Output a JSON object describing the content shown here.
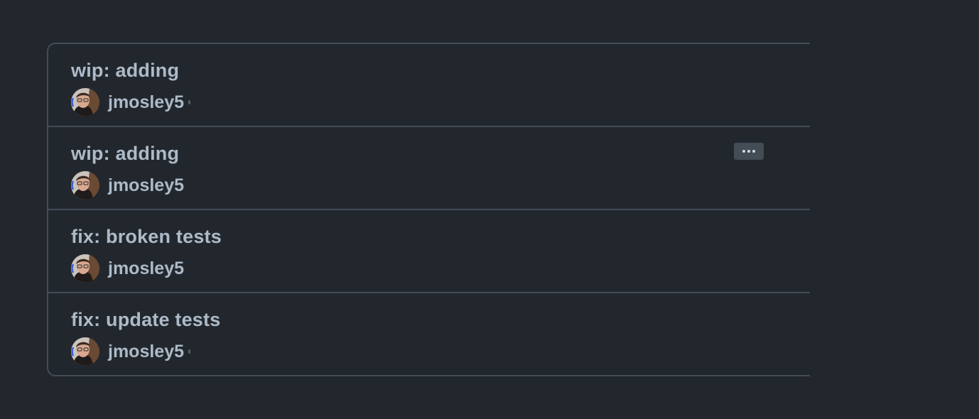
{
  "commits": [
    {
      "title": "wip: adding",
      "author": "jmosley5"
    },
    {
      "title": "wip: adding",
      "author": "jmosley5"
    },
    {
      "title": "fix: broken tests",
      "author": "jmosley5"
    },
    {
      "title": "fix: update tests",
      "author": "jmosley5"
    }
  ],
  "icons": {
    "more": "kebab-horizontal-icon",
    "avatar": "user-avatar"
  },
  "colors": {
    "background": "#22272e",
    "border": "#444c56",
    "text": "#adbac7",
    "button_bg": "#444c56"
  }
}
